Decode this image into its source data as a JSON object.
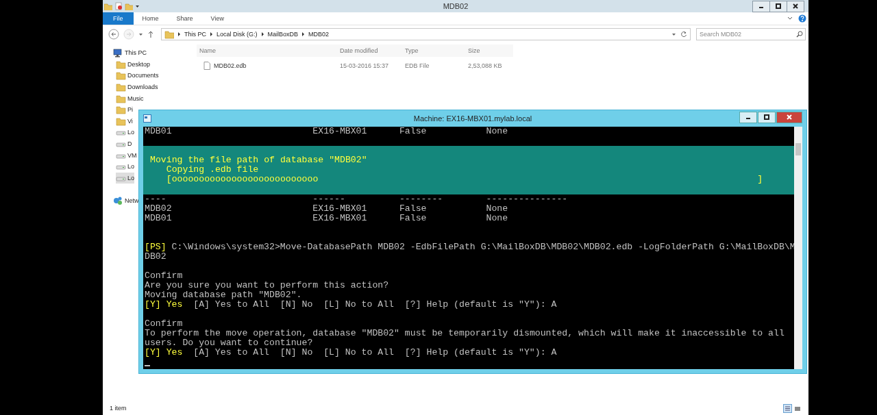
{
  "explorer": {
    "title": "MDB02",
    "ribbon_tabs": [
      {
        "label": "File",
        "selected": true
      },
      {
        "label": "Home",
        "selected": false
      },
      {
        "label": "Share",
        "selected": false
      },
      {
        "label": "View",
        "selected": false
      }
    ],
    "breadcrumb": [
      "This PC",
      "Local Disk (G:)",
      "MailBoxDB",
      "MDB02"
    ],
    "search": {
      "placeholder": "Search MDB02"
    },
    "sidebar": {
      "items": [
        {
          "label": "This PC",
          "kind": "pc",
          "selected": false,
          "children": [
            {
              "label": "Desktop",
              "kind": "folder",
              "selected": false
            },
            {
              "label": "Documents",
              "kind": "folder",
              "selected": false
            },
            {
              "label": "Downloads",
              "kind": "folder",
              "selected": false
            },
            {
              "label": "Music",
              "kind": "folder",
              "selected": false
            },
            {
              "label": "Pi",
              "kind": "folder",
              "selected": false
            },
            {
              "label": "Vi",
              "kind": "folder",
              "selected": false
            },
            {
              "label": "Lo",
              "kind": "drive",
              "selected": false
            },
            {
              "label": "D",
              "kind": "drive",
              "selected": false
            },
            {
              "label": "VM",
              "kind": "drive",
              "selected": false
            },
            {
              "label": "Lo",
              "kind": "drive",
              "selected": false
            },
            {
              "label": "Lo",
              "kind": "drive",
              "selected": true
            }
          ]
        },
        {
          "label": "Netw",
          "kind": "network",
          "selected": false
        }
      ]
    },
    "table": {
      "columns": [
        "Name",
        "Date modified",
        "Type",
        "Size"
      ],
      "rows": [
        {
          "name": "MDB02.edb",
          "date_modified": "15-03-2016 15:37",
          "type": "EDB File",
          "size": "2,53,088 KB"
        }
      ]
    },
    "status_bar": "1 item"
  },
  "console": {
    "title": "Machine: EX16-MBX01.mylab.local",
    "lines": [
      {
        "kind": "row",
        "cells": [
          "MDB01",
          "EX16-MBX01",
          "False",
          "None"
        ]
      },
      {
        "kind": "blank"
      },
      {
        "kind": "progress",
        "title": "Moving the file path of database \"MDB02\"",
        "activity": "Copying .edb file",
        "bar_open": "[ooooooooooooooooooooooooooo",
        "bar_close": "]"
      },
      {
        "kind": "row",
        "cells": [
          "----",
          "------",
          "--------",
          "---------------"
        ]
      },
      {
        "kind": "row",
        "cells": [
          "MDB02",
          "EX16-MBX01",
          "False",
          "None"
        ]
      },
      {
        "kind": "row",
        "cells": [
          "MDB01",
          "EX16-MBX01",
          "False",
          "None"
        ]
      },
      {
        "kind": "blank"
      },
      {
        "kind": "blank"
      },
      {
        "kind": "prompt",
        "prefix": "[PS]",
        "text": "C:\\Windows\\system32>Move-DatabasePath MDB02 -EdbFilePath G:\\MailBoxDB\\MDB02\\MDB02.edb -LogFolderPath G:\\MailBoxDB\\M"
      },
      {
        "kind": "text",
        "text": "DB02"
      },
      {
        "kind": "blank"
      },
      {
        "kind": "text",
        "text": "Confirm"
      },
      {
        "kind": "text",
        "text": "Are you sure you want to perform this action?"
      },
      {
        "kind": "text",
        "text": "Moving database path \"MDB02\"."
      },
      {
        "kind": "choice",
        "default": "[Y] Yes",
        "rest": "[A] Yes to All  [N] No  [L] No to All  [?] Help (default is \"Y\"): A"
      },
      {
        "kind": "blank"
      },
      {
        "kind": "text",
        "text": "Confirm"
      },
      {
        "kind": "text",
        "text": "To perform the move operation, database \"MDB02\" must be temporarily dismounted, which will make it inaccessible to all"
      },
      {
        "kind": "text",
        "text": "users. Do you want to continue?"
      },
      {
        "kind": "choice",
        "default": "[Y] Yes",
        "rest": "[A] Yes to All  [N] No  [L] No to All  [?] Help (default is \"Y\"): A"
      },
      {
        "kind": "cursor"
      }
    ]
  }
}
